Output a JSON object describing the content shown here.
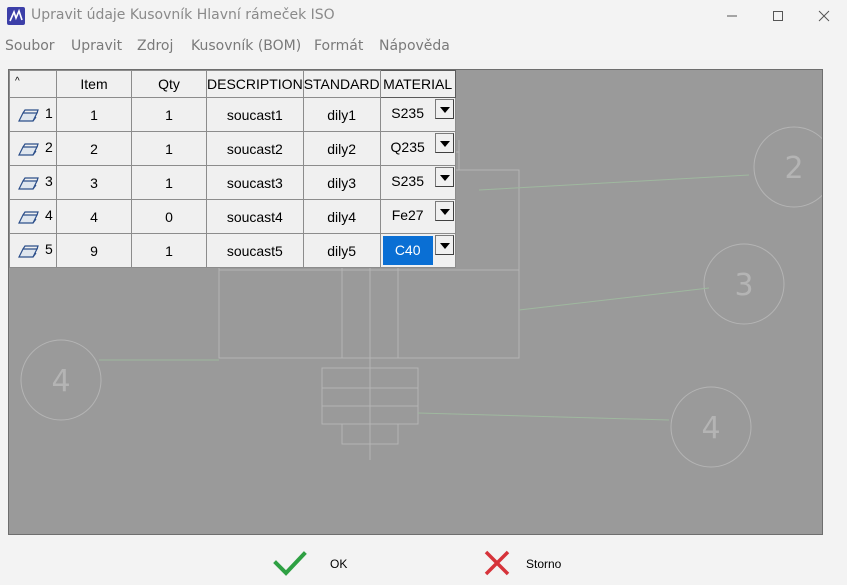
{
  "window": {
    "title": "Upravit údaje Kusovník Hlavní rámeček ISO"
  },
  "menu": [
    "Soubor",
    "Upravit",
    "Zdroj",
    "Kusovník (BOM)",
    "Formát",
    "Nápověda"
  ],
  "table": {
    "corner_label": "^",
    "columns": [
      "Item",
      "Qty",
      "DESCRIPTION",
      "STANDARD",
      "MATERIAL"
    ],
    "rows": [
      {
        "index": "1",
        "item": "1",
        "qty": "1",
        "description": "soucast1",
        "standard": "dily1",
        "material": "S235"
      },
      {
        "index": "2",
        "item": "2",
        "qty": "1",
        "description": "soucast2",
        "standard": "dily2",
        "material": "Q235"
      },
      {
        "index": "3",
        "item": "3",
        "qty": "1",
        "description": "soucast3",
        "standard": "dily3",
        "material": "S235"
      },
      {
        "index": "4",
        "item": "4",
        "qty": "0",
        "description": "soucast4",
        "standard": "dily4",
        "material": "Fe27"
      },
      {
        "index": "5",
        "item": "9",
        "qty": "1",
        "description": "soucast5",
        "standard": "dily5",
        "material": "C40"
      }
    ],
    "selected_row": 4
  },
  "background_callouts": [
    "2",
    "3",
    "4",
    "4"
  ],
  "buttons": {
    "ok": "OK",
    "cancel": "Storno"
  },
  "colors": {
    "selection": "#0a6fd4",
    "ok_check": "#2ea043",
    "cancel_x": "#d6333a"
  }
}
